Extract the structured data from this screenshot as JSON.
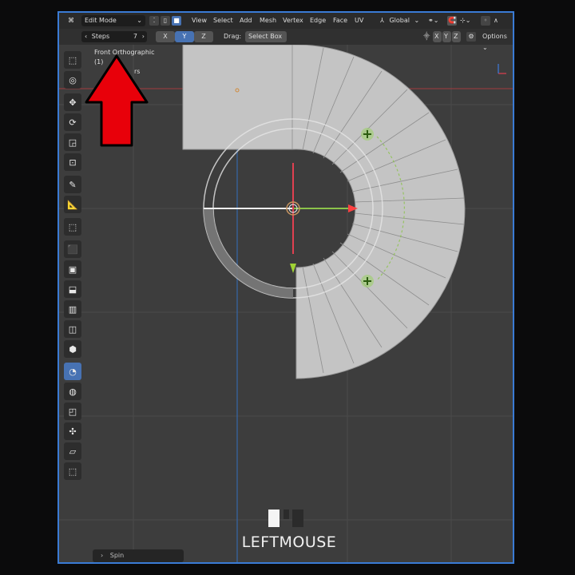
{
  "header": {
    "mode_label": "Edit Mode",
    "menu": [
      "View",
      "Select",
      "Add",
      "Mesh",
      "Vertex",
      "Edge",
      "Face",
      "UV"
    ],
    "orientation_label": "Global"
  },
  "tool_header": {
    "steps_label": "Steps",
    "steps_value": "7",
    "axes": [
      "X",
      "Y",
      "Z"
    ],
    "active_axis": "Y",
    "drag_label": "Drag:",
    "drag_value": "Select Box",
    "mirror_axes": [
      "X",
      "Y",
      "Z"
    ],
    "options_label": "Options"
  },
  "viewport": {
    "view_name": "Front Orthographic",
    "line2": "(1)",
    "line3": "rs"
  },
  "toolbar": {
    "tools": [
      "select-box-icon",
      "cursor-icon",
      "move-icon",
      "rotate-icon",
      "scale-icon",
      "transform-icon",
      "annotate-icon",
      "measure-icon",
      "add-cube-icon",
      "extrude-region-icon",
      "inset-faces-icon",
      "bevel-icon",
      "loop-cut-icon",
      "knife-icon",
      "poly-build-icon",
      "spin-icon",
      "smooth-icon",
      "edge-slide-icon",
      "shrink-fatten-icon",
      "shear-icon",
      "rip-region-icon"
    ],
    "active_tool": "spin-icon"
  },
  "last_operation": {
    "label": "Spin"
  },
  "input_overlay": {
    "text": "LEFTMOUSE"
  },
  "colors": {
    "accent": "#4772b3",
    "frame": "#3a7bd5",
    "arrow": "#e8000a",
    "mesh": "#c8c8c8",
    "gizmo_green": "#8bc34a"
  }
}
